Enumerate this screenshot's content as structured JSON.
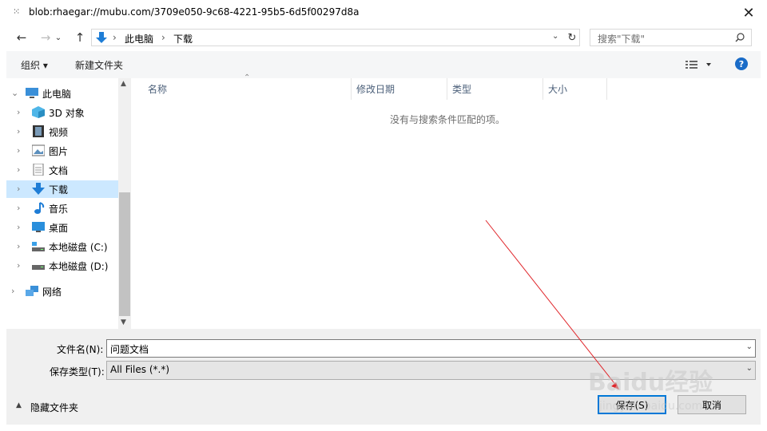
{
  "window": {
    "title": "blob:rhaegar://mubu.com/3709e050-9c68-4221-95b5-6d5f00297d8a",
    "close_icon": "close-icon"
  },
  "address": {
    "path": [
      "此电脑",
      "下载"
    ]
  },
  "search": {
    "placeholder": "搜索\"下载\""
  },
  "toolbar": {
    "organize_label": "组织 ▾",
    "new_folder_label": "新建文件夹",
    "view_icon": "view-options-icon",
    "help_label": "?"
  },
  "nav": {
    "items": [
      {
        "label": "此电脑",
        "icon": "pc-icon",
        "expanded": true
      },
      {
        "label": "3D 对象",
        "icon": "3d-objects-icon"
      },
      {
        "label": "视频",
        "icon": "videos-icon"
      },
      {
        "label": "图片",
        "icon": "pictures-icon"
      },
      {
        "label": "文档",
        "icon": "documents-icon"
      },
      {
        "label": "下载",
        "icon": "downloads-icon",
        "selected": true
      },
      {
        "label": "音乐",
        "icon": "music-icon"
      },
      {
        "label": "桌面",
        "icon": "desktop-icon"
      },
      {
        "label": "本地磁盘 (C:)",
        "icon": "drive-c-icon"
      },
      {
        "label": "本地磁盘 (D:)",
        "icon": "drive-d-icon"
      },
      {
        "label": "网络",
        "icon": "network-icon"
      }
    ]
  },
  "content": {
    "columns": [
      "名称",
      "修改日期",
      "类型",
      "大小"
    ],
    "empty_message": "没有与搜索条件匹配的项。"
  },
  "form": {
    "filename_label": "文件名(N):",
    "filename_value": "问题文档",
    "filetype_label": "保存类型(T):",
    "filetype_value": "All Files (*.*)",
    "hide_folders_label": "隐藏文件夹",
    "save_label": "保存(S)",
    "cancel_label": "取消"
  },
  "watermark": {
    "text": "Baidu经验",
    "subtext": "jingyan.baidu.com"
  },
  "colors": {
    "accent": "#0078d7",
    "selection": "#cce8ff",
    "annotation": "#e0262b"
  }
}
